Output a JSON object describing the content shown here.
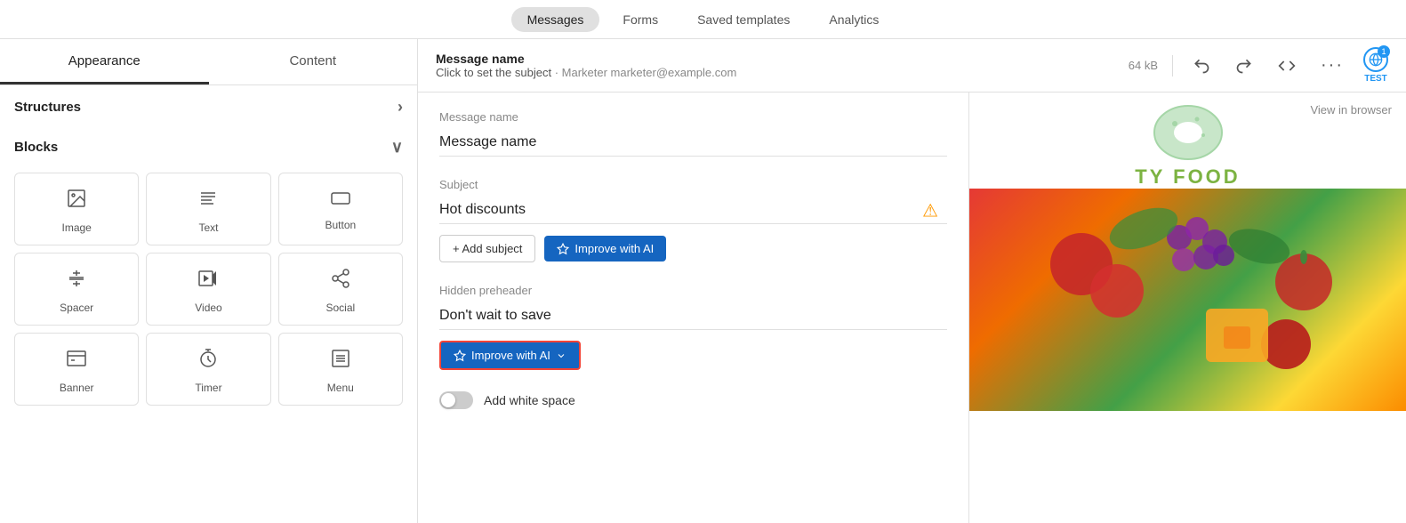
{
  "nav": {
    "tabs": [
      {
        "id": "messages",
        "label": "Messages",
        "active": true
      },
      {
        "id": "forms",
        "label": "Forms",
        "active": false
      },
      {
        "id": "saved-templates",
        "label": "Saved templates",
        "active": false
      },
      {
        "id": "analytics",
        "label": "Analytics",
        "active": false
      }
    ]
  },
  "sidebar": {
    "tabs": [
      {
        "id": "appearance",
        "label": "Appearance",
        "active": true
      },
      {
        "id": "content",
        "label": "Content",
        "active": false
      }
    ],
    "structures_label": "Structures",
    "blocks_label": "Blocks",
    "blocks": [
      {
        "id": "image",
        "label": "Image",
        "icon": "🖼"
      },
      {
        "id": "text",
        "label": "Text",
        "icon": "≡"
      },
      {
        "id": "button",
        "label": "Button",
        "icon": "▭"
      },
      {
        "id": "spacer",
        "label": "Spacer",
        "icon": "↕"
      },
      {
        "id": "video",
        "label": "Video",
        "icon": "▶"
      },
      {
        "id": "social",
        "label": "Social",
        "icon": "⋈"
      },
      {
        "id": "banner",
        "label": "Banner",
        "icon": "☰"
      },
      {
        "id": "timer",
        "label": "Timer",
        "icon": "⟳"
      },
      {
        "id": "menu",
        "label": "Menu",
        "icon": "⊟"
      }
    ]
  },
  "header": {
    "message_name_label": "Message name",
    "click_to_set": "Click to set the subject",
    "email": "· Marketer marketer@example.com",
    "file_size": "64 kB",
    "test_label": "TEST"
  },
  "form": {
    "message_name_label": "Message name",
    "message_name_value": "Message name",
    "subject_label": "Subject",
    "subject_value": "Hot discounts",
    "add_subject_label": "+ Add subject",
    "improve_ai_label": "Improve with AI",
    "hidden_preheader_label": "Hidden preheader",
    "preheader_value": "Don't wait to save",
    "improve_ai_preheader_label": "Improve with AI",
    "add_white_space_label": "Add white space",
    "view_in_browser_label": "View in browser"
  }
}
